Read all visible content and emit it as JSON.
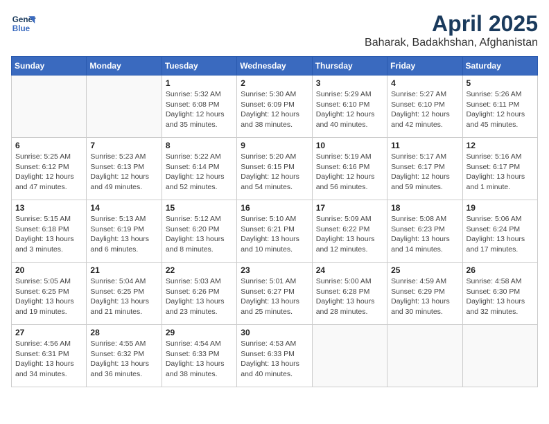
{
  "header": {
    "logo_line1": "General",
    "logo_line2": "Blue",
    "month": "April 2025",
    "location": "Baharak, Badakhshan, Afghanistan"
  },
  "weekdays": [
    "Sunday",
    "Monday",
    "Tuesday",
    "Wednesday",
    "Thursday",
    "Friday",
    "Saturday"
  ],
  "weeks": [
    [
      {
        "day": "",
        "info": ""
      },
      {
        "day": "",
        "info": ""
      },
      {
        "day": "1",
        "info": "Sunrise: 5:32 AM\nSunset: 6:08 PM\nDaylight: 12 hours and 35 minutes."
      },
      {
        "day": "2",
        "info": "Sunrise: 5:30 AM\nSunset: 6:09 PM\nDaylight: 12 hours and 38 minutes."
      },
      {
        "day": "3",
        "info": "Sunrise: 5:29 AM\nSunset: 6:10 PM\nDaylight: 12 hours and 40 minutes."
      },
      {
        "day": "4",
        "info": "Sunrise: 5:27 AM\nSunset: 6:10 PM\nDaylight: 12 hours and 42 minutes."
      },
      {
        "day": "5",
        "info": "Sunrise: 5:26 AM\nSunset: 6:11 PM\nDaylight: 12 hours and 45 minutes."
      }
    ],
    [
      {
        "day": "6",
        "info": "Sunrise: 5:25 AM\nSunset: 6:12 PM\nDaylight: 12 hours and 47 minutes."
      },
      {
        "day": "7",
        "info": "Sunrise: 5:23 AM\nSunset: 6:13 PM\nDaylight: 12 hours and 49 minutes."
      },
      {
        "day": "8",
        "info": "Sunrise: 5:22 AM\nSunset: 6:14 PM\nDaylight: 12 hours and 52 minutes."
      },
      {
        "day": "9",
        "info": "Sunrise: 5:20 AM\nSunset: 6:15 PM\nDaylight: 12 hours and 54 minutes."
      },
      {
        "day": "10",
        "info": "Sunrise: 5:19 AM\nSunset: 6:16 PM\nDaylight: 12 hours and 56 minutes."
      },
      {
        "day": "11",
        "info": "Sunrise: 5:17 AM\nSunset: 6:17 PM\nDaylight: 12 hours and 59 minutes."
      },
      {
        "day": "12",
        "info": "Sunrise: 5:16 AM\nSunset: 6:17 PM\nDaylight: 13 hours and 1 minute."
      }
    ],
    [
      {
        "day": "13",
        "info": "Sunrise: 5:15 AM\nSunset: 6:18 PM\nDaylight: 13 hours and 3 minutes."
      },
      {
        "day": "14",
        "info": "Sunrise: 5:13 AM\nSunset: 6:19 PM\nDaylight: 13 hours and 6 minutes."
      },
      {
        "day": "15",
        "info": "Sunrise: 5:12 AM\nSunset: 6:20 PM\nDaylight: 13 hours and 8 minutes."
      },
      {
        "day": "16",
        "info": "Sunrise: 5:10 AM\nSunset: 6:21 PM\nDaylight: 13 hours and 10 minutes."
      },
      {
        "day": "17",
        "info": "Sunrise: 5:09 AM\nSunset: 6:22 PM\nDaylight: 13 hours and 12 minutes."
      },
      {
        "day": "18",
        "info": "Sunrise: 5:08 AM\nSunset: 6:23 PM\nDaylight: 13 hours and 14 minutes."
      },
      {
        "day": "19",
        "info": "Sunrise: 5:06 AM\nSunset: 6:24 PM\nDaylight: 13 hours and 17 minutes."
      }
    ],
    [
      {
        "day": "20",
        "info": "Sunrise: 5:05 AM\nSunset: 6:25 PM\nDaylight: 13 hours and 19 minutes."
      },
      {
        "day": "21",
        "info": "Sunrise: 5:04 AM\nSunset: 6:25 PM\nDaylight: 13 hours and 21 minutes."
      },
      {
        "day": "22",
        "info": "Sunrise: 5:03 AM\nSunset: 6:26 PM\nDaylight: 13 hours and 23 minutes."
      },
      {
        "day": "23",
        "info": "Sunrise: 5:01 AM\nSunset: 6:27 PM\nDaylight: 13 hours and 25 minutes."
      },
      {
        "day": "24",
        "info": "Sunrise: 5:00 AM\nSunset: 6:28 PM\nDaylight: 13 hours and 28 minutes."
      },
      {
        "day": "25",
        "info": "Sunrise: 4:59 AM\nSunset: 6:29 PM\nDaylight: 13 hours and 30 minutes."
      },
      {
        "day": "26",
        "info": "Sunrise: 4:58 AM\nSunset: 6:30 PM\nDaylight: 13 hours and 32 minutes."
      }
    ],
    [
      {
        "day": "27",
        "info": "Sunrise: 4:56 AM\nSunset: 6:31 PM\nDaylight: 13 hours and 34 minutes."
      },
      {
        "day": "28",
        "info": "Sunrise: 4:55 AM\nSunset: 6:32 PM\nDaylight: 13 hours and 36 minutes."
      },
      {
        "day": "29",
        "info": "Sunrise: 4:54 AM\nSunset: 6:33 PM\nDaylight: 13 hours and 38 minutes."
      },
      {
        "day": "30",
        "info": "Sunrise: 4:53 AM\nSunset: 6:33 PM\nDaylight: 13 hours and 40 minutes."
      },
      {
        "day": "",
        "info": ""
      },
      {
        "day": "",
        "info": ""
      },
      {
        "day": "",
        "info": ""
      }
    ]
  ]
}
